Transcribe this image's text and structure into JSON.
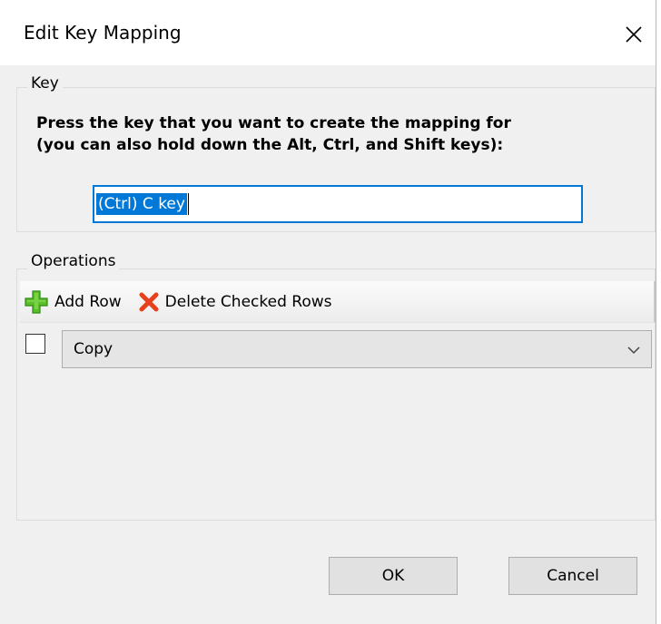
{
  "dialog": {
    "title": "Edit Key Mapping"
  },
  "key_group": {
    "legend": "Key",
    "prompt_line1": "Press the key that you want to create the mapping for",
    "prompt_line2": "(you can also hold down the Alt, Ctrl, and Shift keys):",
    "key_value": "(Ctrl) C key"
  },
  "operations_group": {
    "legend": "Operations",
    "add_row_label": "Add Row",
    "delete_rows_label": "Delete Checked Rows",
    "rows": [
      {
        "checked": false,
        "operation": "Copy"
      }
    ]
  },
  "buttons": {
    "ok": "OK",
    "cancel": "Cancel"
  },
  "icons": {
    "add": "plus-icon",
    "delete": "x-icon",
    "close": "close-icon",
    "dropdown": "chevron-down-icon"
  },
  "colors": {
    "accent": "#0078d7",
    "add_green": "#5bbf2a",
    "delete_red": "#e8401c"
  }
}
